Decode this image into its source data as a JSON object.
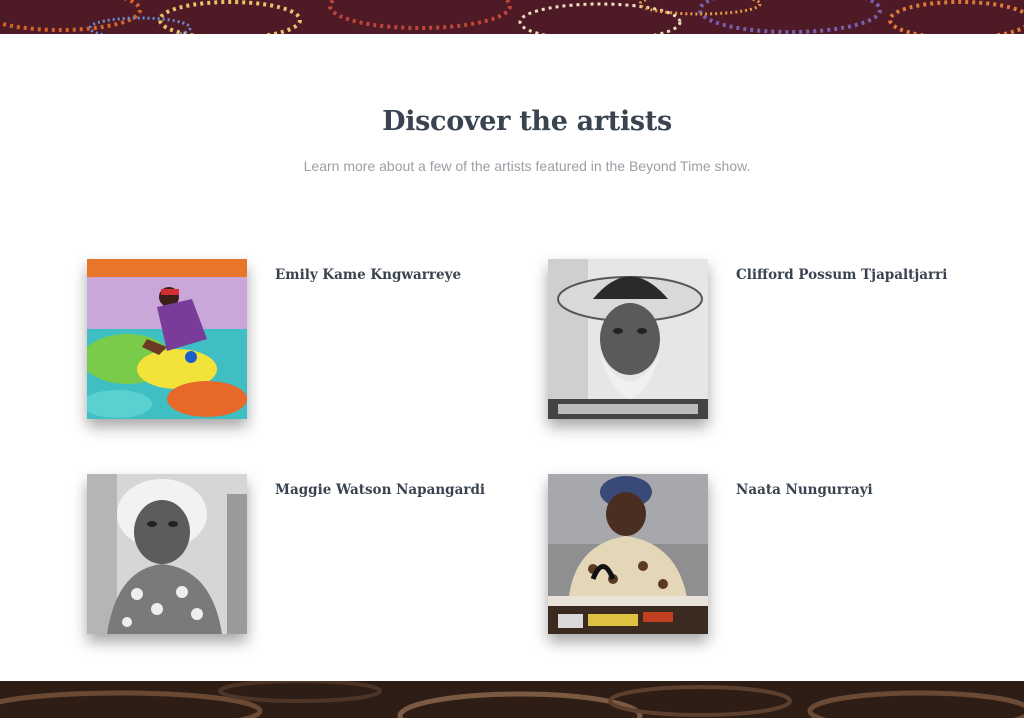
{
  "section": {
    "title": "Discover the artists",
    "subtitle": "Learn more about a few of the artists featured in the Beyond Time show."
  },
  "artists": [
    {
      "name": "Emily Kame Kngwarreye"
    },
    {
      "name": "Clifford Possum Tjapaltjarri"
    },
    {
      "name": "Maggie Watson Napangardi"
    },
    {
      "name": "Naata Nungurrayi"
    }
  ],
  "colors": {
    "heading": "#3a4450",
    "subtitle": "#9aa0a6",
    "background": "#ffffff"
  }
}
